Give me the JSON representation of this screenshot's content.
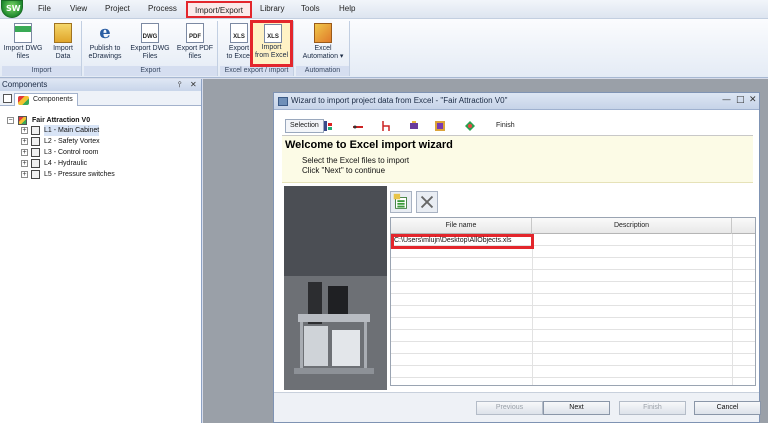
{
  "menu": {
    "items": [
      "File",
      "View",
      "Project",
      "Process",
      "Import/Export",
      "Library",
      "Tools",
      "Help"
    ],
    "active": "Import/Export"
  },
  "ribbon": {
    "groups": [
      {
        "label": "Import",
        "buttons": [
          "Import DWG\nfiles",
          "Import\nData"
        ]
      },
      {
        "label": "Export",
        "buttons": [
          "Publish to\neDrawings",
          "Export DWG\nFiles",
          "Export PDF\nfiles"
        ]
      },
      {
        "label": "Excel export / import",
        "buttons": [
          "Export\nto Excel",
          "Import\nfrom Excel"
        ]
      },
      {
        "label": "Automation",
        "buttons": [
          "Excel\nAutomation ▾"
        ]
      }
    ],
    "icon_text": {
      "dwg": "DWG",
      "pdf": "PDF",
      "xls": "XLS"
    }
  },
  "components_panel": {
    "title": "Components",
    "tab_label": "Components",
    "pin": "✕",
    "tree": {
      "root": "Fair Attraction V0",
      "children": [
        "L1 - Main Cabinet",
        "L2 - Safety Vortex",
        "L3 - Control room",
        "L4 - Hydraulic",
        "L5 - Pressure switches"
      ]
    }
  },
  "wizard": {
    "title": "Wizard to import project data from Excel - \"Fair Attraction V0\"",
    "steps": {
      "selection": "Selection",
      "finish": "Finish"
    },
    "heading": "Welcome to Excel import wizard",
    "subtitle_1": "Select the Excel files to import",
    "subtitle_2": "Click \"Next\" to continue",
    "grid": {
      "columns": [
        "File name",
        "Description"
      ],
      "rows": [
        {
          "file": "C:\\Users\\mlujn\\Desktop\\AllObjects.xls",
          "description": ""
        }
      ]
    },
    "buttons": {
      "previous": "Previous",
      "next": "Next",
      "finish": "Finish",
      "cancel": "Cancel"
    }
  },
  "colors": {
    "highlight": "#e3262c",
    "ribbon_bg": "#e4ebf5",
    "panel_title": "#c8d5ea"
  }
}
